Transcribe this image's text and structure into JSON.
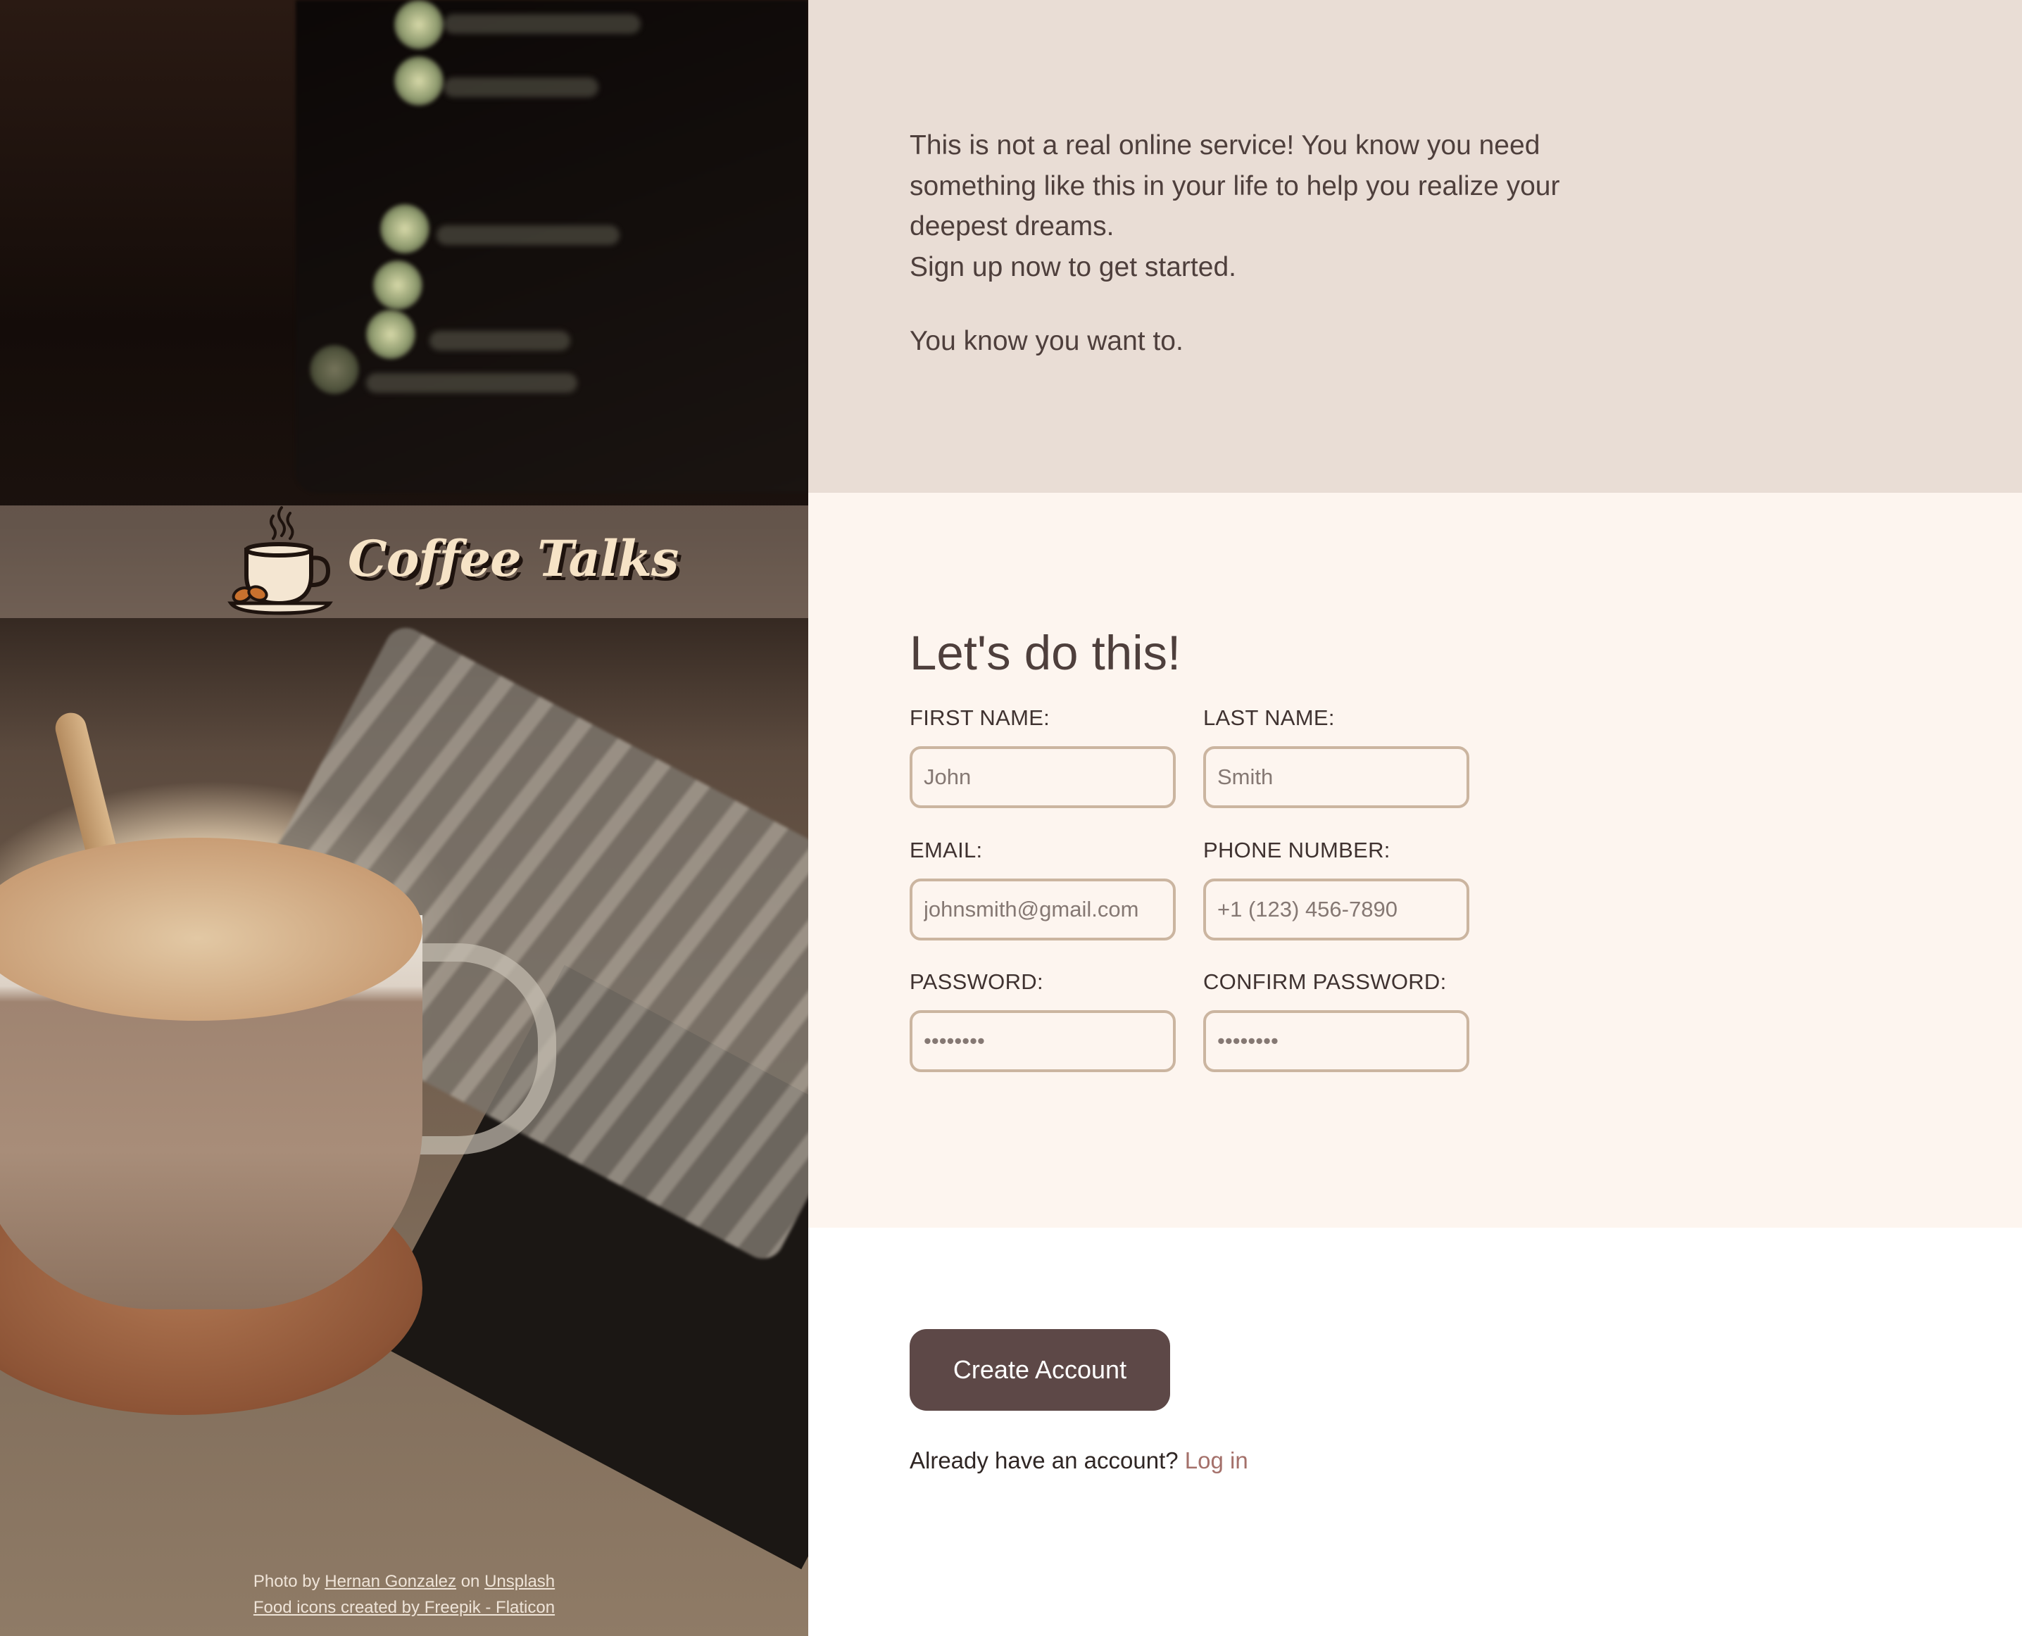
{
  "brand": {
    "name": "Coffee Talks",
    "icon": "coffee-cup-icon"
  },
  "credits": {
    "photo_prefix": "Photo by",
    "photographer": "Hernan Gonzalez",
    "on": "on",
    "site": "Unsplash",
    "icons_credit": "Food icons created by Freepik - Flaticon"
  },
  "intro": {
    "paragraph1_line1": "This is not a real online service! You know you need something like this in your life to help you realize your deepest dreams.",
    "paragraph1_line2": "Sign up now to get started.",
    "paragraph2": "You know you want to."
  },
  "form": {
    "heading": "Let's do this!",
    "first_name": {
      "label": "FIRST NAME:",
      "placeholder": "John"
    },
    "last_name": {
      "label": "LAST NAME:",
      "placeholder": "Smith"
    },
    "email": {
      "label": "EMAIL:",
      "placeholder": "johnsmith@gmail.com"
    },
    "phone": {
      "label": "PHONE NUMBER:",
      "placeholder": "+1 (123) 456-7890"
    },
    "password": {
      "label": "PASSWORD:",
      "placeholder": "••••••••"
    },
    "confirm_password": {
      "label": "CONFIRM PASSWORD:",
      "placeholder": "••••••••"
    }
  },
  "actions": {
    "create_button": "Create Account",
    "login_prompt": "Already have an account?",
    "login_link": "Log in"
  },
  "colors": {
    "accent": "#5d4847",
    "intro_bg": "#e9ddd5",
    "form_bg": "#fdf5ef",
    "input_border": "#cbb5a0",
    "link": "#a4706a",
    "logo_text": "#f6e3c6"
  }
}
